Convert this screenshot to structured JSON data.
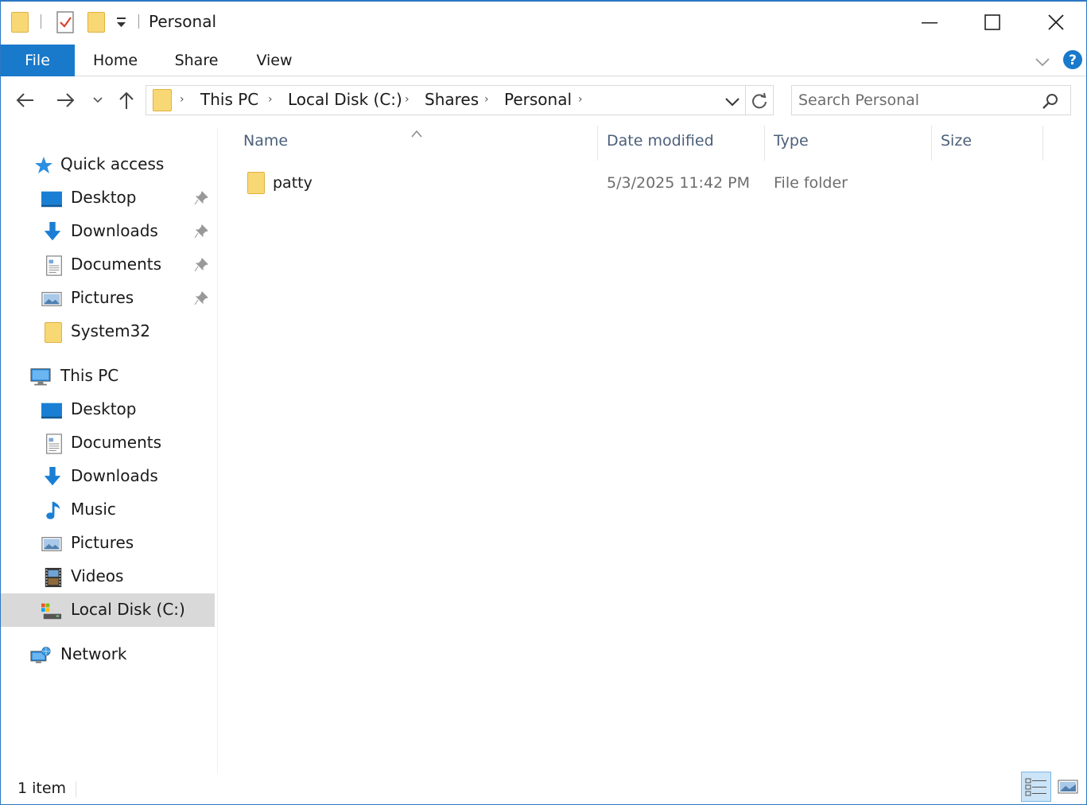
{
  "window": {
    "title": "Personal"
  },
  "ribbon": {
    "tabs": [
      {
        "label": "File"
      },
      {
        "label": "Home"
      },
      {
        "label": "Share"
      },
      {
        "label": "View"
      }
    ]
  },
  "address_bar": {
    "crumbs": [
      "This PC",
      "Local Disk (C:)",
      "Shares",
      "Personal"
    ]
  },
  "search": {
    "placeholder": "Search Personal"
  },
  "nav_pane": {
    "quick_access": {
      "label": "Quick access",
      "items": [
        {
          "label": "Desktop",
          "icon": "desktop-icon",
          "pinned": true
        },
        {
          "label": "Downloads",
          "icon": "downloads-icon",
          "pinned": true
        },
        {
          "label": "Documents",
          "icon": "documents-icon",
          "pinned": true
        },
        {
          "label": "Pictures",
          "icon": "pictures-icon",
          "pinned": true
        },
        {
          "label": "System32",
          "icon": "folder-icon",
          "pinned": false
        }
      ]
    },
    "this_pc": {
      "label": "This PC",
      "items": [
        {
          "label": "Desktop",
          "icon": "desktop-icon"
        },
        {
          "label": "Documents",
          "icon": "documents-icon"
        },
        {
          "label": "Downloads",
          "icon": "downloads-icon"
        },
        {
          "label": "Music",
          "icon": "music-icon"
        },
        {
          "label": "Pictures",
          "icon": "pictures-icon"
        },
        {
          "label": "Videos",
          "icon": "videos-icon"
        },
        {
          "label": "Local Disk (C:)",
          "icon": "local-disk-icon",
          "selected": true
        }
      ]
    },
    "network": {
      "label": "Network"
    }
  },
  "file_list": {
    "columns": {
      "name": "Name",
      "date_modified": "Date modified",
      "type": "Type",
      "size": "Size"
    },
    "rows": [
      {
        "name": "patty",
        "date_modified": "5/3/2025 11:42 PM",
        "type": "File folder",
        "size": ""
      }
    ]
  },
  "status_bar": {
    "item_count": "1 item"
  },
  "colors": {
    "accent": "#1979ca",
    "folder": "#f8d775",
    "header_text": "#4c607a",
    "selected_bg": "#d9d9d9"
  }
}
